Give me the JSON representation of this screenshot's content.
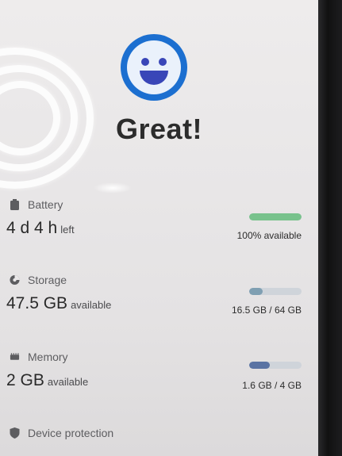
{
  "status": {
    "icon": "smiley-face-icon",
    "title": "Great!"
  },
  "battery": {
    "label": "Battery",
    "icon": "battery-icon",
    "value": "4 d 4 h",
    "suffix": "left",
    "detail": "100% available",
    "fraction": 1.0,
    "bar_color": "#78c28c"
  },
  "storage": {
    "label": "Storage",
    "icon": "storage-pie-icon",
    "value": "47.5 GB",
    "suffix": "available",
    "detail": "16.5 GB / 64 GB",
    "fraction": 0.26,
    "bar_color": "#7f9fb2"
  },
  "memory": {
    "label": "Memory",
    "icon": "memory-chip-icon",
    "value": "2 GB",
    "suffix": "available",
    "detail": "1.6 GB / 4 GB",
    "fraction": 0.4,
    "bar_color": "#5a73a3"
  },
  "protection": {
    "label": "Device protection",
    "icon": "shield-icon"
  },
  "colors": {
    "accent": "#1c6fd0",
    "face_features": "#3946b8"
  }
}
